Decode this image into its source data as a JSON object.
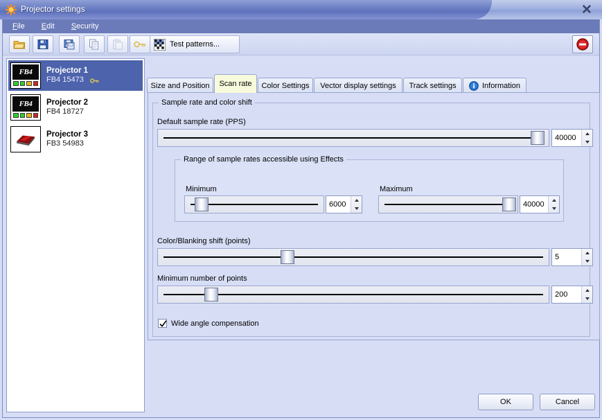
{
  "window": {
    "title": "Projector settings",
    "close_label": "✕",
    "app_icon": "starburst-icon"
  },
  "menubar": {
    "items": [
      {
        "label": "File",
        "accel": "F"
      },
      {
        "label": "Edit",
        "accel": "E"
      },
      {
        "label": "Security",
        "accel": "S"
      }
    ]
  },
  "toolbar": {
    "buttons": [
      {
        "name": "open-icon",
        "tip": "Open"
      },
      {
        "name": "save-icon",
        "tip": "Save"
      },
      {
        "name": "save-as-icon",
        "tip": "Save as"
      },
      {
        "name": "copy-icon",
        "tip": "Copy"
      },
      {
        "name": "paste-icon",
        "tip": "Paste"
      },
      {
        "name": "key-icon",
        "tip": "Key"
      }
    ],
    "test_patterns_label": "Test patterns...",
    "test_patterns_icon": "checkerboard-icon",
    "stop_icon": "stop-sign-icon"
  },
  "sidebar": {
    "projectors": [
      {
        "name": "Projector 1",
        "device": "FB4 15473",
        "icon": "fb4-icon",
        "has_key": true,
        "selected": true
      },
      {
        "name": "Projector 2",
        "device": "FB4 18727",
        "icon": "fb4-icon",
        "has_key": false,
        "selected": false
      },
      {
        "name": "Projector 3",
        "device": "FB3 54983",
        "icon": "fb3-icon",
        "has_key": false,
        "selected": false
      }
    ],
    "fb4_label": "FB4",
    "led_colors": [
      "#2ecc2e",
      "#2ecc2e",
      "#e8b317",
      "#d42424"
    ]
  },
  "tabs": [
    {
      "label": "Size and Position",
      "active": false,
      "icon": null
    },
    {
      "label": "Scan rate",
      "active": true,
      "icon": null
    },
    {
      "label": "Color Settings",
      "active": false,
      "icon": null
    },
    {
      "label": "Vector display settings",
      "active": false,
      "icon": null
    },
    {
      "label": "Track settings",
      "active": false,
      "icon": null
    },
    {
      "label": "Information",
      "active": false,
      "icon": "info-icon"
    }
  ],
  "panel": {
    "group_title": "Sample rate and color shift",
    "default_sample_rate": {
      "label": "Default sample rate (PPS)",
      "value": "40000",
      "thumb_pct": 97
    },
    "range_group": {
      "title": "Range of sample rates accessible using Effects",
      "minimum": {
        "label": "Minimum",
        "value": "6000",
        "thumb_pct": 9
      },
      "maximum": {
        "label": "Maximum",
        "value": "40000",
        "thumb_pct": 95
      }
    },
    "color_blanking_shift": {
      "label": "Color/Blanking shift (points)",
      "value": "5",
      "thumb_pct": 32
    },
    "minimum_points": {
      "label": "Minimum number of points",
      "value": "200",
      "thumb_pct": 12
    },
    "wide_angle": {
      "label": "Wide angle compensation",
      "checked": true
    }
  },
  "buttons": {
    "ok_label": "OK",
    "cancel_label": "Cancel"
  },
  "colors": {
    "window_bg": "#d6ddf5",
    "menubar_bg": "#6b7ab8",
    "selection_blue": "#4d63ab",
    "active_tab_bg": "#f7fbdc",
    "title_blue": "#5e72bd"
  }
}
